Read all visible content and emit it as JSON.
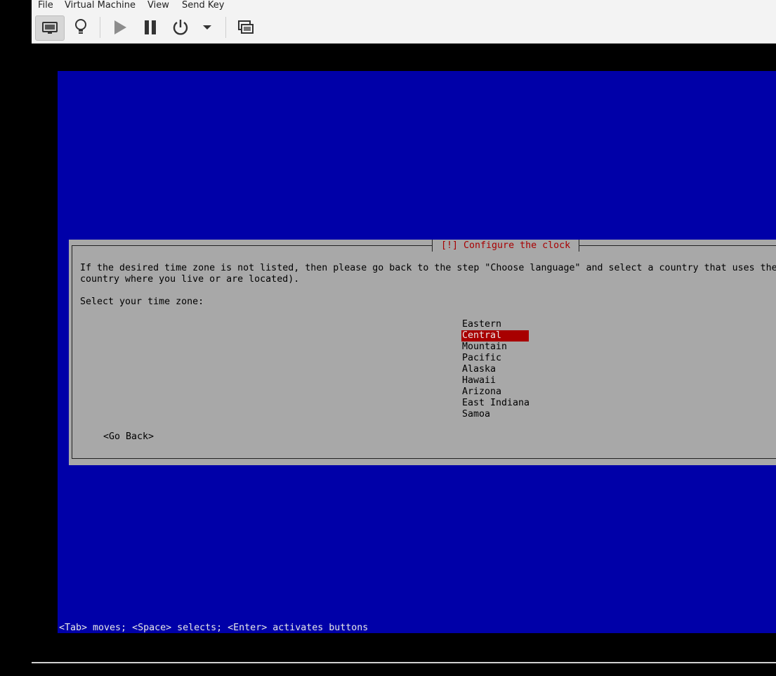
{
  "menubar": {
    "items": [
      "File",
      "Virtual Machine",
      "View",
      "Send Key"
    ]
  },
  "toolbar": {
    "buttons": [
      {
        "icon": "monitor-icon",
        "active": true
      },
      {
        "icon": "lightbulb-icon"
      },
      {
        "icon": "play-icon"
      },
      {
        "icon": "pause-icon"
      },
      {
        "icon": "power-icon"
      },
      {
        "icon": "dropdown-arrow-icon"
      },
      {
        "icon": "screenshot-windows-icon"
      }
    ]
  },
  "installer": {
    "dialog_title": "[!] Configure the clock",
    "description_line1": "If the desired time zone is not listed, then please go back to the step \"Choose language\" and select a country that uses the",
    "description_line2": "country where you live or are located).",
    "prompt": "Select your time zone:",
    "timezones": [
      "Eastern",
      "Central",
      "Mountain",
      "Pacific",
      "Alaska",
      "Hawaii",
      "Arizona",
      "East Indiana",
      "Samoa"
    ],
    "selected_timezone": "Central",
    "go_back_label": "<Go Back>",
    "hint": "<Tab> moves; <Space> selects; <Enter> activates buttons"
  },
  "colors": {
    "screen_background": "#0000a8",
    "dialog_background": "#a8a8a8",
    "title_color": "#a80000",
    "selection_background": "#a80000"
  }
}
